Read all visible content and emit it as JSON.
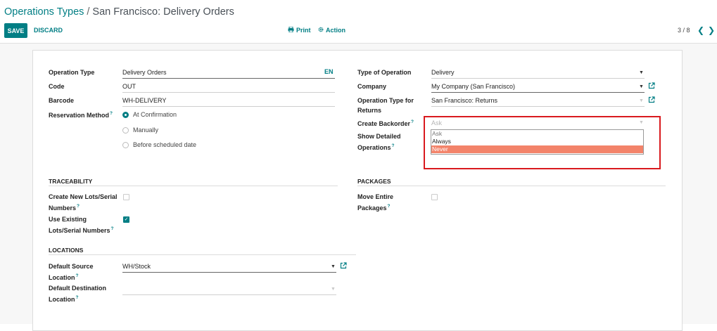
{
  "breadcrumb": {
    "parent": "Operations Types",
    "separator": "/",
    "current": "San Francisco: Delivery Orders"
  },
  "toolbar": {
    "save_label": "SAVE",
    "discard_label": "DISCARD",
    "print_label": "Print",
    "action_label": "Action"
  },
  "pager": {
    "value": "3 / 8",
    "prev": "❮",
    "next": "❯"
  },
  "form": {
    "left": {
      "operation_type": {
        "label": "Operation Type",
        "value": "Delivery Orders",
        "lang": "EN"
      },
      "code": {
        "label": "Code",
        "value": "OUT"
      },
      "barcode": {
        "label": "Barcode",
        "value": "WH-DELIVERY"
      },
      "reservation_method": {
        "label": "Reservation Method",
        "help": "?",
        "options": [
          "At Confirmation",
          "Manually",
          "Before scheduled date"
        ],
        "selected": "At Confirmation"
      }
    },
    "right": {
      "type_of_operation": {
        "label": "Type of Operation",
        "value": "Delivery"
      },
      "company": {
        "label": "Company",
        "value": "My Company (San Francisco)"
      },
      "return_type": {
        "label_line1": "Operation Type for",
        "label_line2": "Returns",
        "value": "San Francisco: Returns"
      },
      "create_backorder": {
        "label": "Create Backorder",
        "help": "?",
        "value": "Ask",
        "dropdown_options": [
          "Ask",
          "Always",
          "Never"
        ],
        "highlighted": "Never"
      },
      "show_detailed": {
        "label_line1": "Show Detailed",
        "label_line2": "Operations",
        "help": "?"
      }
    },
    "traceability": {
      "title": "TRACEABILITY",
      "create_lots": {
        "label_line1": "Create New Lots/Serial",
        "label_line2": "Numbers",
        "help": "?",
        "checked": false
      },
      "use_existing": {
        "label_line1": "Use Existing",
        "label_line2": "Lots/Serial Numbers",
        "help": "?",
        "checked": true
      }
    },
    "packages": {
      "title": "PACKAGES",
      "move_entire": {
        "label_line1": "Move Entire",
        "label_line2": "Packages",
        "help": "?",
        "checked": false
      }
    },
    "locations": {
      "title": "LOCATIONS",
      "default_source": {
        "label_line1": "Default Source",
        "label_line2": "Location",
        "help": "?",
        "value": "WH/Stock"
      },
      "default_destination": {
        "label_line1": "Default Destination",
        "label_line2": "Location",
        "help": "?",
        "value": ""
      }
    }
  },
  "colors": {
    "accent": "#017e84",
    "highlight": "#f3836a",
    "annotation": "#d9191e"
  }
}
